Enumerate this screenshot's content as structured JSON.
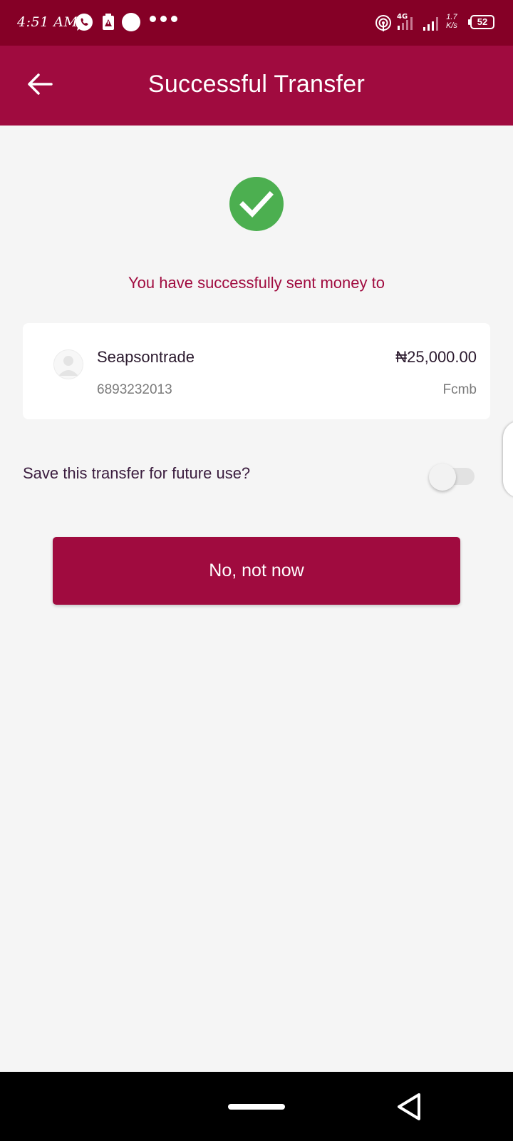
{
  "status_bar": {
    "time": "4:51 AM",
    "network": "4G",
    "speed_top": "1.7",
    "speed_bottom": "K/s",
    "battery": "52",
    "icons": [
      "whatsapp-icon",
      "alert-app-icon",
      "circle-app-icon",
      "more-notifications-icon",
      "hotspot-icon",
      "signal-icon",
      "signal-icon",
      "battery-icon"
    ]
  },
  "app_bar": {
    "title": "Successful Transfer",
    "back_icon": "arrow-left-icon"
  },
  "success": {
    "icon": "check-circle-icon",
    "message": "You have successfully sent money to"
  },
  "recipient": {
    "name": "Seapsontrade",
    "account_number": "6893232013",
    "amount": "₦25,000.00",
    "bank": "Fcmb"
  },
  "save_transfer": {
    "label": "Save this transfer for future use?",
    "enabled": false
  },
  "actions": {
    "decline_label": "No, not now"
  },
  "colors": {
    "status_bar": "#850026",
    "primary": "#a00b3f",
    "success": "#4caf50",
    "background": "#f5f5f5"
  }
}
